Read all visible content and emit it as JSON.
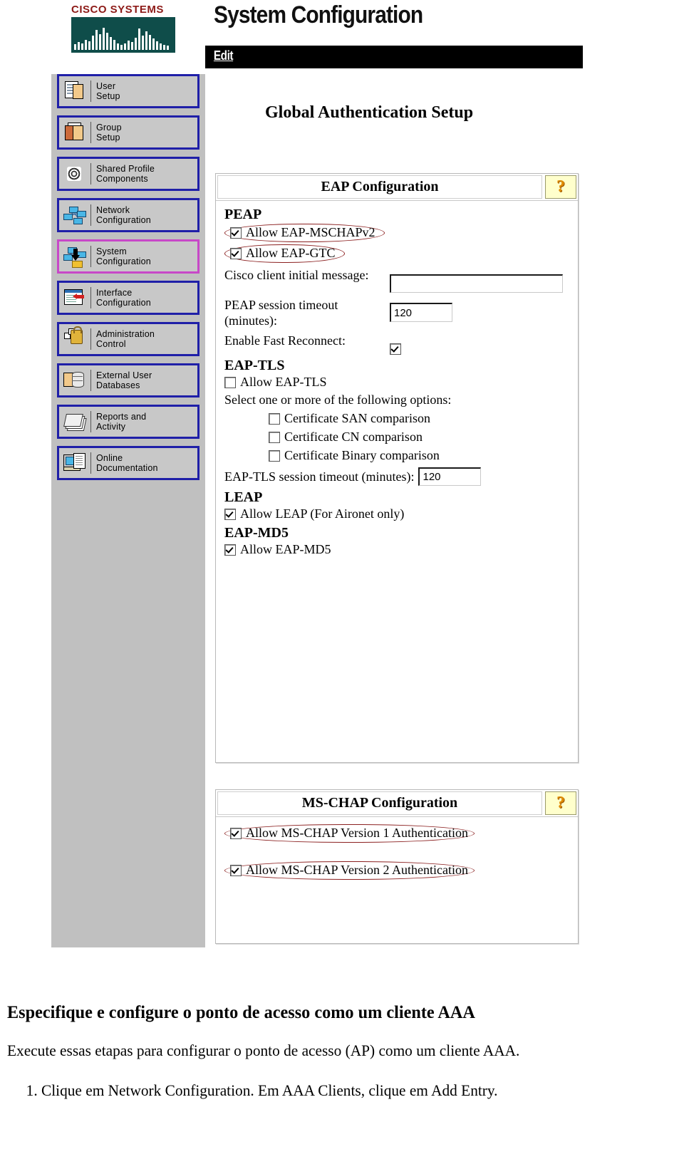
{
  "brand": {
    "line1": "CISCO SYSTEMS",
    "logo_text_color": "#8d1a17",
    "logo_bridge_color": "#0f4d4a"
  },
  "header": {
    "page_title": "System Configuration",
    "edit_label": "Edit",
    "section_title": "Global Authentication Setup"
  },
  "sidebar": {
    "items": [
      {
        "label": "User\nSetup",
        "icon": "user-document-icon",
        "selected": false
      },
      {
        "label": "Group\nSetup",
        "icon": "group-people-icon",
        "selected": false
      },
      {
        "label": "Shared Profile\nComponents",
        "icon": "gear-cluster-icon",
        "selected": false
      },
      {
        "label": "Network\nConfiguration",
        "icon": "network-nodes-icon",
        "selected": false
      },
      {
        "label": "System\nConfiguration",
        "icon": "network-download-icon",
        "selected": true
      },
      {
        "label": "Interface\nConfiguration",
        "icon": "window-red-arrow-icon",
        "selected": false
      },
      {
        "label": "Administration\nControl",
        "icon": "padlock-icon",
        "selected": false
      },
      {
        "label": "External User\nDatabases",
        "icon": "database-card-icon",
        "selected": false
      },
      {
        "label": "Reports and\nActivity",
        "icon": "stacked-papers-icon",
        "selected": false
      },
      {
        "label": "Online\nDocumentation",
        "icon": "monitor-document-icon",
        "selected": false
      }
    ]
  },
  "eap_panel": {
    "title": "EAP Configuration",
    "help_glyph": "?",
    "peap": {
      "heading": "PEAP",
      "allow_mschapv2": {
        "label": "Allow EAP-MSCHAPv2",
        "checked": true,
        "annotated": true
      },
      "allow_gtc": {
        "label": "Allow EAP-GTC",
        "checked": true,
        "annotated": true
      },
      "cisco_client_initial_message": {
        "label": "Cisco client initial message:",
        "value": ""
      },
      "peap_session_timeout": {
        "label": "PEAP session timeout (minutes):",
        "value": "120"
      },
      "enable_fast_reconnect": {
        "label": "Enable Fast Reconnect:",
        "checked": true
      }
    },
    "eap_tls": {
      "heading": "EAP-TLS",
      "allow_eap_tls": {
        "label": "Allow EAP-TLS",
        "checked": false
      },
      "select_note": "Select one or more of the following options:",
      "options": [
        {
          "label": "Certificate SAN comparison",
          "checked": false
        },
        {
          "label": "Certificate CN comparison",
          "checked": false
        },
        {
          "label": "Certificate Binary comparison",
          "checked": false
        }
      ],
      "session_timeout": {
        "label": "EAP-TLS session timeout (minutes):",
        "value": "120"
      }
    },
    "leap": {
      "heading": "LEAP",
      "allow_leap": {
        "label": "Allow LEAP (For Aironet only)",
        "checked": true
      }
    },
    "eap_md5": {
      "heading": "EAP-MD5",
      "allow_eap_md5": {
        "label": "Allow EAP-MD5",
        "checked": true
      }
    }
  },
  "mschap_panel": {
    "title": "MS-CHAP Configuration",
    "help_glyph": "?",
    "version1": {
      "label": "Allow MS-CHAP Version 1 Authentication",
      "checked": true,
      "annotated": true
    },
    "version2": {
      "label": "Allow MS-CHAP Version 2 Authentication",
      "checked": true,
      "annotated": true
    }
  },
  "article": {
    "heading": "Especifique e configure o ponto de acesso como um cliente AAA",
    "paragraph": "Execute essas etapas para configurar o ponto de acesso (AP) como um cliente AAA.",
    "steps": [
      "Clique em Network Configuration. Em AAA Clients, clique em Add Entry."
    ]
  },
  "annotation_color": "#8b2020"
}
